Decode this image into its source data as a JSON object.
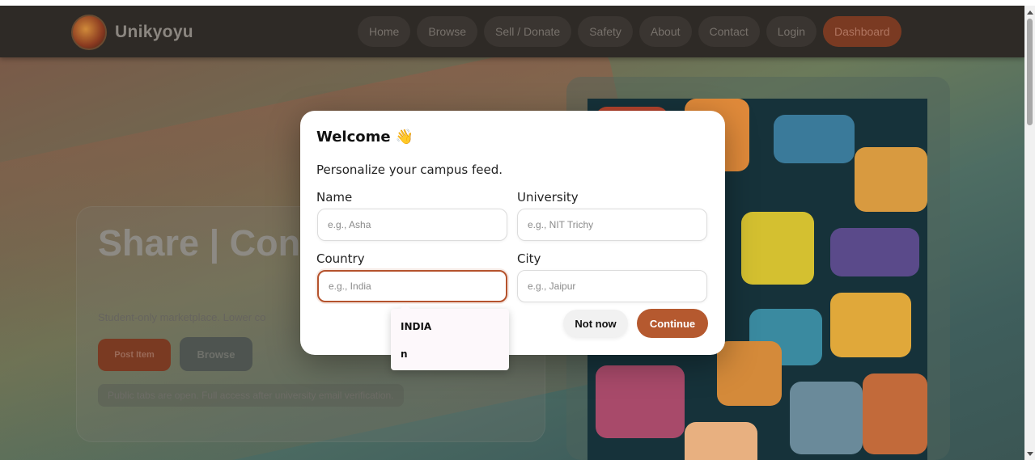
{
  "brand": {
    "name": "Unikyoyu"
  },
  "nav": {
    "items": [
      "Home",
      "Browse",
      "Sell / Donate",
      "Safety",
      "About",
      "Contact",
      "Login"
    ],
    "dashboard": "Dashboard",
    "accent": "#7a3a22"
  },
  "hero": {
    "title": "Share | Con Thrive",
    "subtitle": "Student-only marketplace. Lower co",
    "post_button": "Post Item",
    "browse_button": "Browse",
    "note": "Public tabs are open. Full access after university email verification."
  },
  "modal": {
    "title": "Welcome 👋",
    "subtitle": "Personalize your campus feed.",
    "fields": {
      "name": {
        "label": "Name",
        "placeholder": "e.g., Asha"
      },
      "university": {
        "label": "University",
        "placeholder": "e.g., NIT Trichy"
      },
      "country": {
        "label": "Country",
        "placeholder": "e.g., India"
      },
      "city": {
        "label": "City",
        "placeholder": "e.g., Jaipur"
      }
    },
    "not_now": "Not now",
    "continue": "Continue",
    "accent": "#b5592f"
  },
  "autocomplete": {
    "options": [
      "INDIA",
      "n"
    ]
  }
}
